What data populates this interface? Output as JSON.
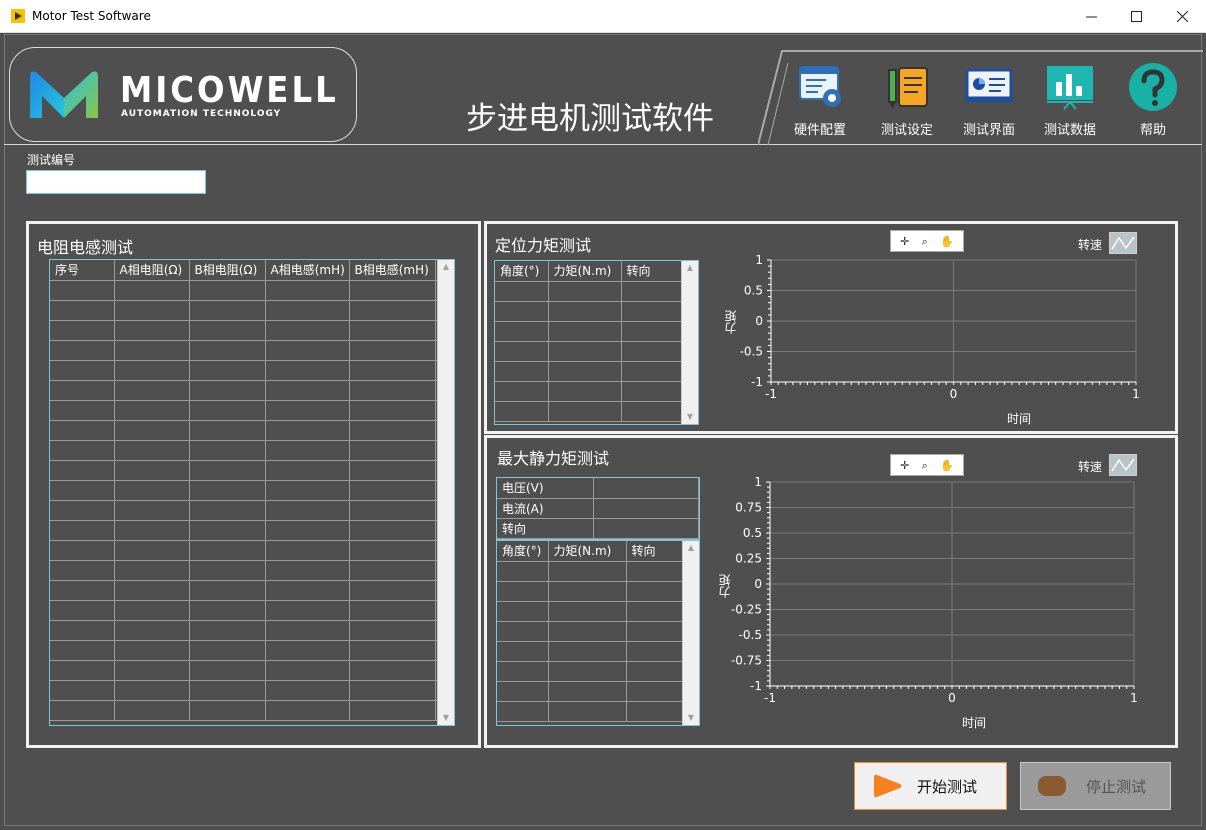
{
  "window": {
    "title": "Motor Test Software"
  },
  "header": {
    "brand": "MICOWELL",
    "tagline": "AUTOMATION TECHNOLOGY",
    "app_title": "步进电机测试软件",
    "toolbar": [
      {
        "label": "硬件配置",
        "icon": "hardware-config-icon"
      },
      {
        "label": "测试设定",
        "icon": "test-settings-icon"
      },
      {
        "label": "测试界面",
        "icon": "test-ui-icon"
      },
      {
        "label": "测试数据",
        "icon": "test-data-icon"
      },
      {
        "label": "帮助",
        "icon": "help-icon"
      }
    ]
  },
  "test_no": {
    "label": "测试编号",
    "value": ""
  },
  "resistance_panel": {
    "title": "电阻电感测试",
    "columns": [
      "序号",
      "A相电阻(Ω)",
      "B相电阻(Ω)",
      "A相电感(mH)",
      "B相电感(mH)"
    ]
  },
  "detent_panel": {
    "title": "定位力矩测试",
    "columns": [
      "角度(°)",
      "力矩(N.m)",
      "转向"
    ],
    "speed_label": "转速",
    "chart_data": {
      "type": "line",
      "xlabel": "时间",
      "ylabel": "力矩",
      "xlim": [
        -1,
        1
      ],
      "ylim": [
        -1,
        1
      ],
      "x_ticks": [
        "-1",
        "0",
        "1"
      ],
      "y_ticks": [
        "1",
        "0.5",
        "0",
        "-0.5",
        "-1"
      ],
      "series": []
    }
  },
  "holding_panel": {
    "title": "最大静力矩测试",
    "kv": [
      {
        "label": "电压(V)",
        "value": ""
      },
      {
        "label": "电流(A)",
        "value": ""
      },
      {
        "label": "转向",
        "value": ""
      }
    ],
    "columns": [
      "角度(°)",
      "力矩(N.m)",
      "转向"
    ],
    "speed_label": "转速",
    "chart_data": {
      "type": "line",
      "xlabel": "时间",
      "ylabel": "力矩",
      "xlim": [
        -1,
        1
      ],
      "ylim": [
        -1,
        1
      ],
      "x_ticks": [
        "-1",
        "0",
        "1"
      ],
      "y_ticks": [
        "1",
        "0.75",
        "0.5",
        "0.25",
        "0",
        "-0.25",
        "-0.5",
        "-0.75",
        "-1"
      ],
      "series": []
    }
  },
  "buttons": {
    "start": "开始测试",
    "stop": "停止测试"
  },
  "colors": {
    "background": "#4f4f4f",
    "accent": "#f28c28",
    "table_border": "#7fc7d4"
  }
}
